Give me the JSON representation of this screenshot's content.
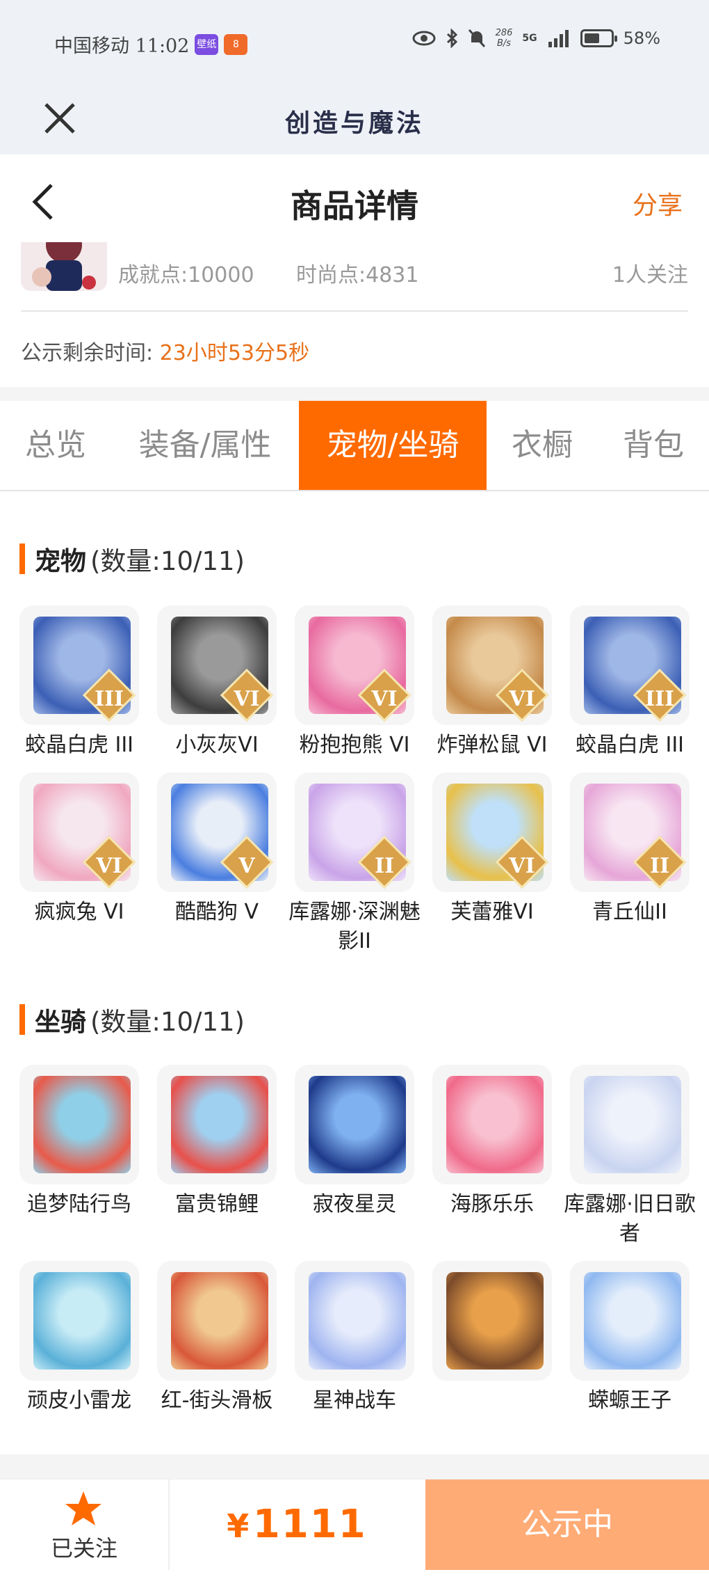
{
  "status_bar": {
    "carrier_time": "中国移动 11:02",
    "badge1": "壁纸",
    "badge2": "8",
    "net_top": "286",
    "net_bottom": "B/s",
    "signal": "5G",
    "battery_percent": "58%",
    "battery_level": 0.58
  },
  "app": {
    "title": "创造与魔法"
  },
  "nav": {
    "title": "商品详情",
    "share": "分享"
  },
  "info": {
    "achievement": "成就点:10000",
    "fashion": "时尚点:4831",
    "followers": "1人关注"
  },
  "countdown": {
    "label": "公示剩余时间:",
    "time": "23小时53分5秒"
  },
  "tabs": [
    "总览",
    "装备/属性",
    "宠物/坐骑",
    "衣橱",
    "背包"
  ],
  "active_tab": "宠物/坐骑",
  "pets": {
    "title": "宠物",
    "count": "(数量:10/11)",
    "items": [
      {
        "label": "蛟晶白虎 III",
        "grade": "III"
      },
      {
        "label": "小灰灰VI",
        "grade": "VI"
      },
      {
        "label": "粉抱抱熊 VI",
        "grade": "VI"
      },
      {
        "label": "炸弹松鼠 VI",
        "grade": "VI"
      },
      {
        "label": "蛟晶白虎 III",
        "grade": "III"
      },
      {
        "label": "疯疯兔 VI",
        "grade": "VI"
      },
      {
        "label": "酷酷狗 V",
        "grade": "V"
      },
      {
        "label": "库露娜·深渊魅影II",
        "grade": "II"
      },
      {
        "label": "芙蕾雅VI",
        "grade": "VI"
      },
      {
        "label": "青丘仙II",
        "grade": "II"
      }
    ]
  },
  "mounts": {
    "title": "坐骑",
    "count": "(数量:10/11)",
    "items": [
      {
        "label": "追梦陆行鸟"
      },
      {
        "label": "富贵锦鲤"
      },
      {
        "label": "寂夜星灵"
      },
      {
        "label": "海豚乐乐"
      },
      {
        "label": "库露娜·旧日歌者"
      },
      {
        "label": "顽皮小雷龙"
      },
      {
        "label": "红-街头滑板"
      },
      {
        "label": "星神战车"
      },
      {
        "label": ""
      },
      {
        "label": "蝾螈王子"
      }
    ]
  },
  "bottom": {
    "follow_label": "已关注",
    "currency": "¥",
    "price": "1111",
    "status": "公示中"
  },
  "colors": {
    "accent": "#ff6a00",
    "countdown": "#e8711a",
    "status_button": "#ffab76"
  }
}
